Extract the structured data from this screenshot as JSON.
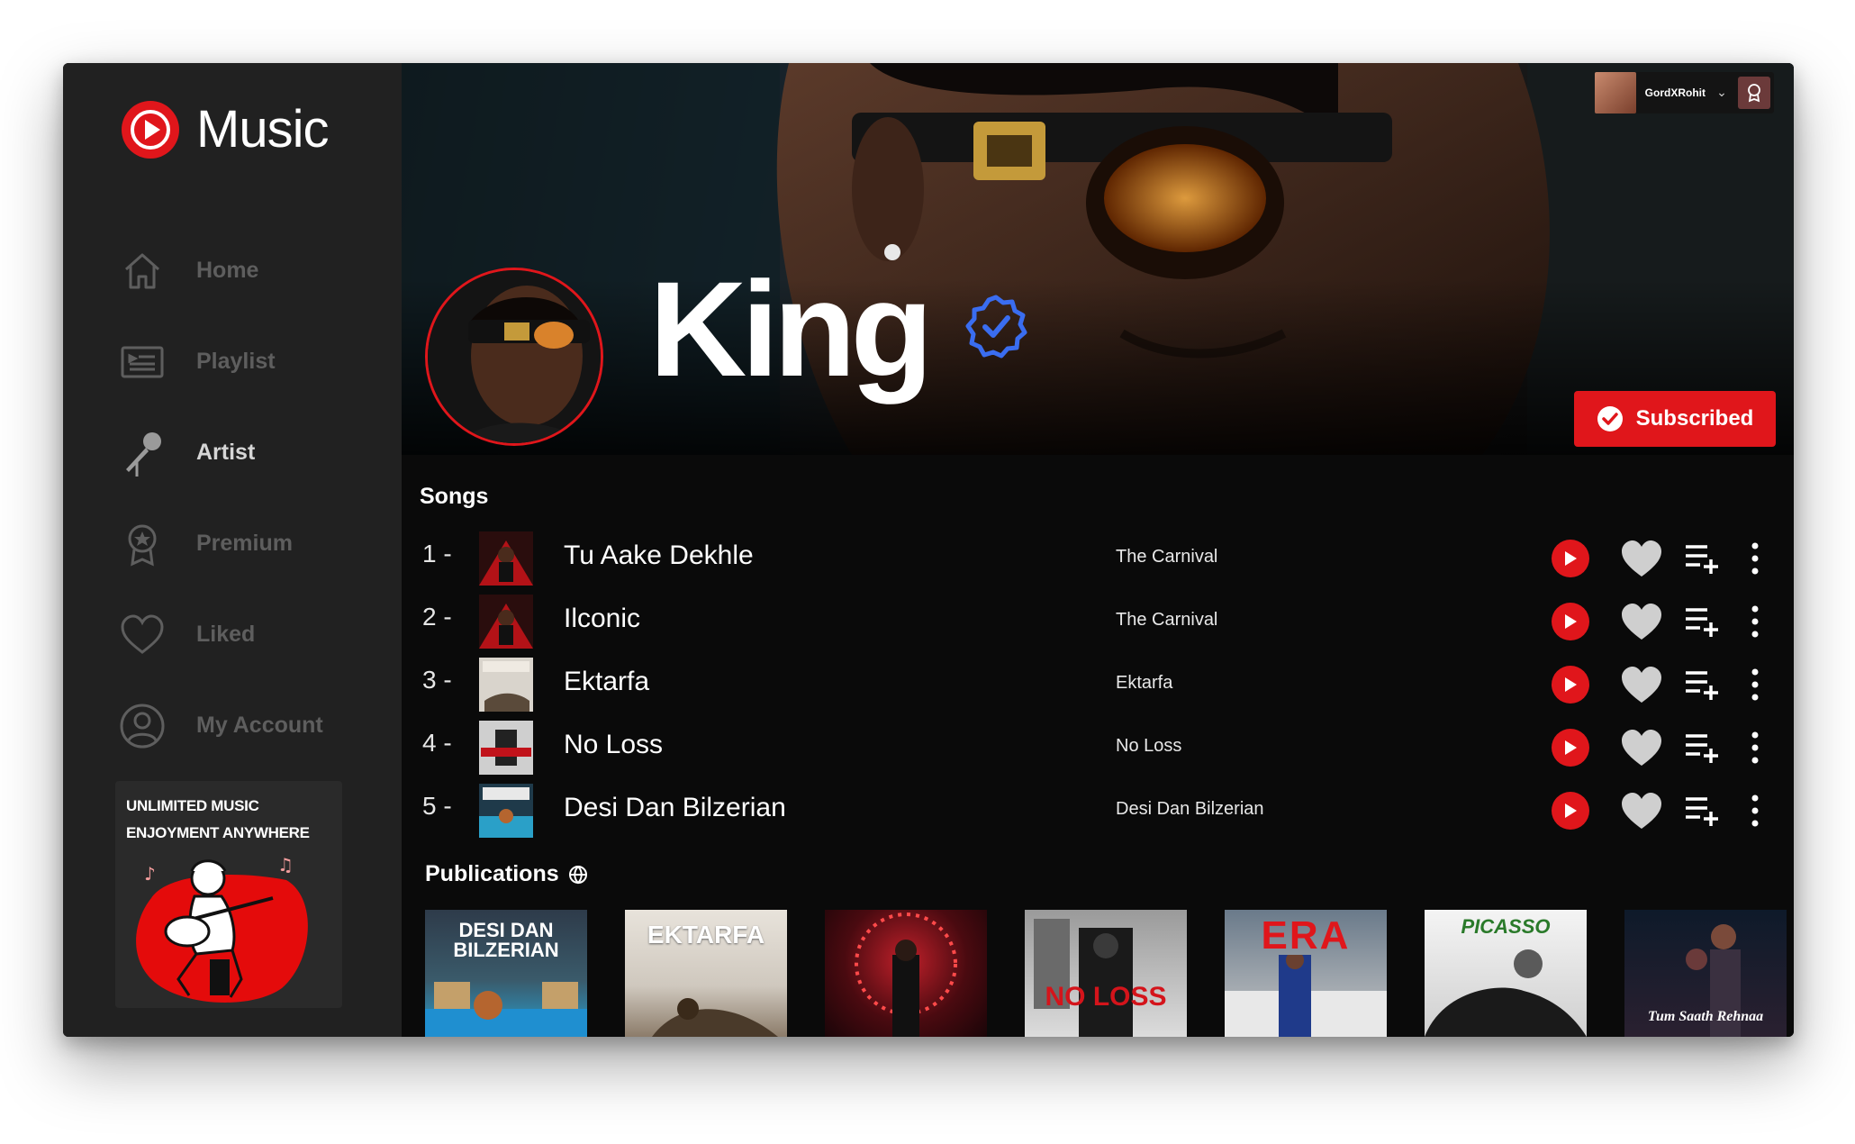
{
  "app": {
    "name": "Music",
    "brand_color": "#e0161b"
  },
  "sidebar": {
    "items": [
      {
        "label": "Home",
        "icon": "home-icon",
        "active": false
      },
      {
        "label": "Playlist",
        "icon": "playlist-icon",
        "active": false
      },
      {
        "label": "Artist",
        "icon": "microphone-icon",
        "active": true
      },
      {
        "label": "Premium",
        "icon": "premium-badge-icon",
        "active": false
      },
      {
        "label": "Liked",
        "icon": "heart-icon",
        "active": false
      },
      {
        "label": "My Account",
        "icon": "account-icon",
        "active": false
      }
    ],
    "promo": {
      "line1": "UNLIMITED MUSIC",
      "line2": "ENJOYMENT ANYWHERE"
    }
  },
  "header": {
    "user_name": "GordXRohit"
  },
  "artist": {
    "name": "King",
    "verified": true,
    "subscribe_label": "Subscribed"
  },
  "songs": {
    "title": "Songs",
    "items": [
      {
        "num": "1 -",
        "title": "Tu Aake Dekhle",
        "album": "The Carnival"
      },
      {
        "num": "2 -",
        "title": "Ilconic",
        "album": "The Carnival"
      },
      {
        "num": "3 -",
        "title": "Ektarfa",
        "album": "Ektarfa"
      },
      {
        "num": "4 -",
        "title": "No Loss",
        "album": "No Loss"
      },
      {
        "num": "5 -",
        "title": "Desi Dan Bilzerian",
        "album": "Desi Dan Bilzerian"
      }
    ]
  },
  "publications": {
    "title": "Publications",
    "items": [
      {
        "cover_text": "DESI DAN BILZERIAN"
      },
      {
        "cover_text": "EKTARFA"
      },
      {
        "cover_text": ""
      },
      {
        "cover_text": "NO LOSS"
      },
      {
        "cover_text": "ERA"
      },
      {
        "cover_text": "PICASSO"
      },
      {
        "cover_text": "Tum Saath Rehnaa"
      }
    ]
  }
}
